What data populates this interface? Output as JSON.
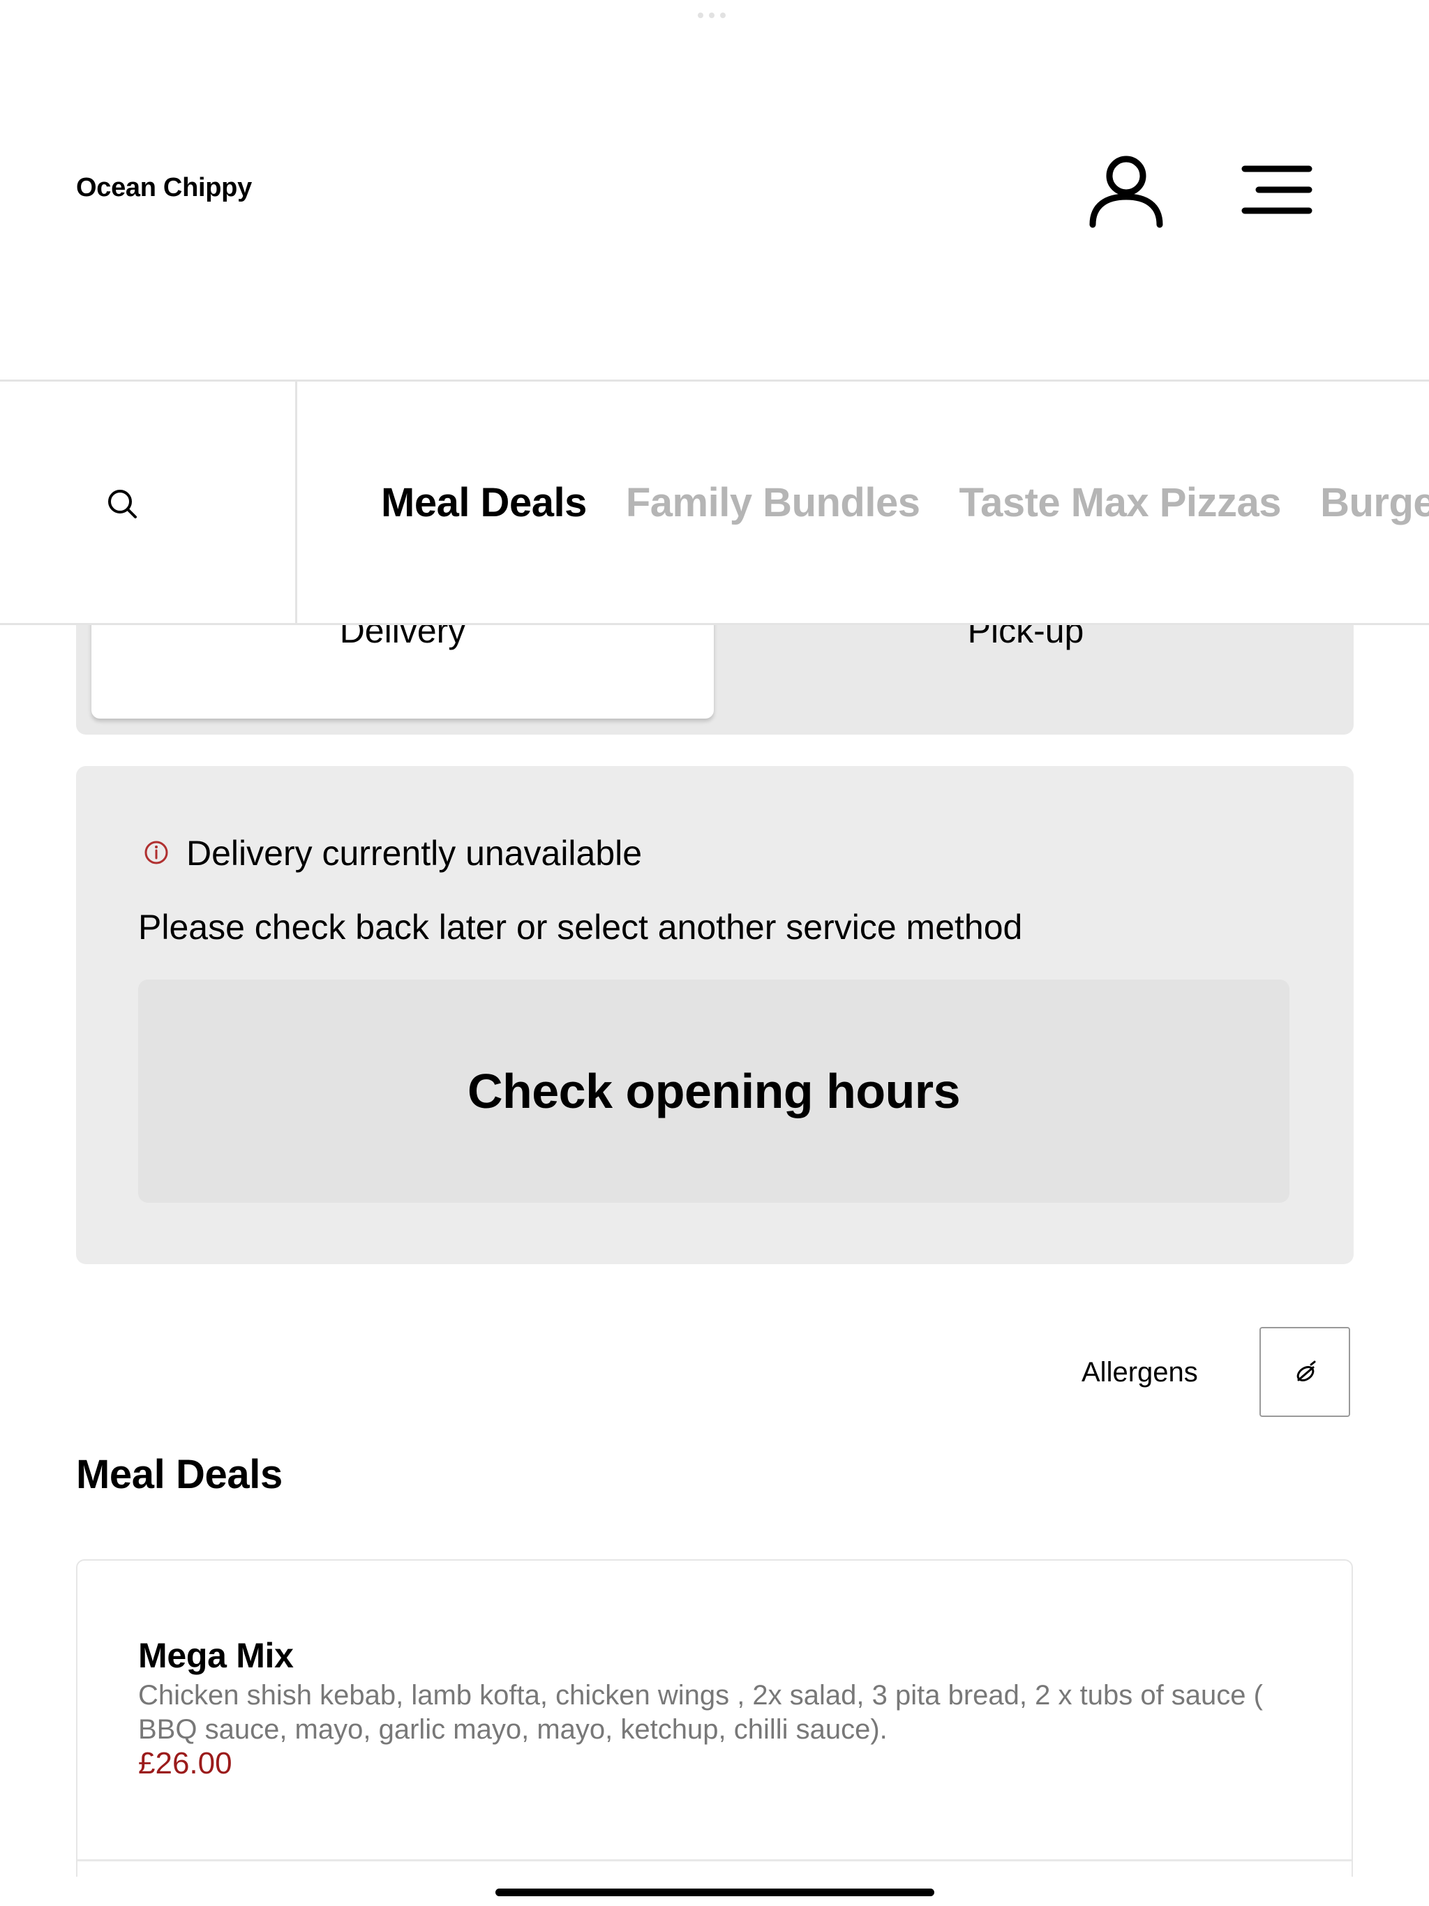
{
  "header": {
    "brand": "Ocean Chippy",
    "account_icon": "user-icon",
    "menu_icon": "hamburger-menu-icon"
  },
  "category_bar": {
    "search_icon": "search-icon",
    "tabs": [
      {
        "label": "Meal Deals",
        "active": true
      },
      {
        "label": "Family Bundles",
        "active": false
      },
      {
        "label": "Taste Max Pizzas",
        "active": false
      },
      {
        "label": "Burgers",
        "active": false
      }
    ]
  },
  "service": {
    "options": [
      {
        "label": "Delivery",
        "selected": true
      },
      {
        "label": "Pick-up",
        "selected": false
      }
    ]
  },
  "notice": {
    "icon": "info-icon",
    "title": "Delivery currently unavailable",
    "message": "Please check back later or select another service method",
    "button_label": "Check opening hours"
  },
  "allergens": {
    "label": "Allergens",
    "icon": "allergen-filter-icon"
  },
  "section": {
    "title": "Meal Deals",
    "items": [
      {
        "name": "Mega Mix",
        "description": "Chicken shish kebab, lamb kofta, chicken wings , 2x salad, 3 pita bread, 2 x tubs of sauce ( BBQ sauce, mayo, garlic mayo, mayo, ketchup, chilli sauce).",
        "price": "£26.00"
      }
    ]
  },
  "colors": {
    "price": "#9b1b1b",
    "info_icon": "#b03030",
    "inactive_tab": "#b5b5b5",
    "panel_bg": "#ececec"
  }
}
